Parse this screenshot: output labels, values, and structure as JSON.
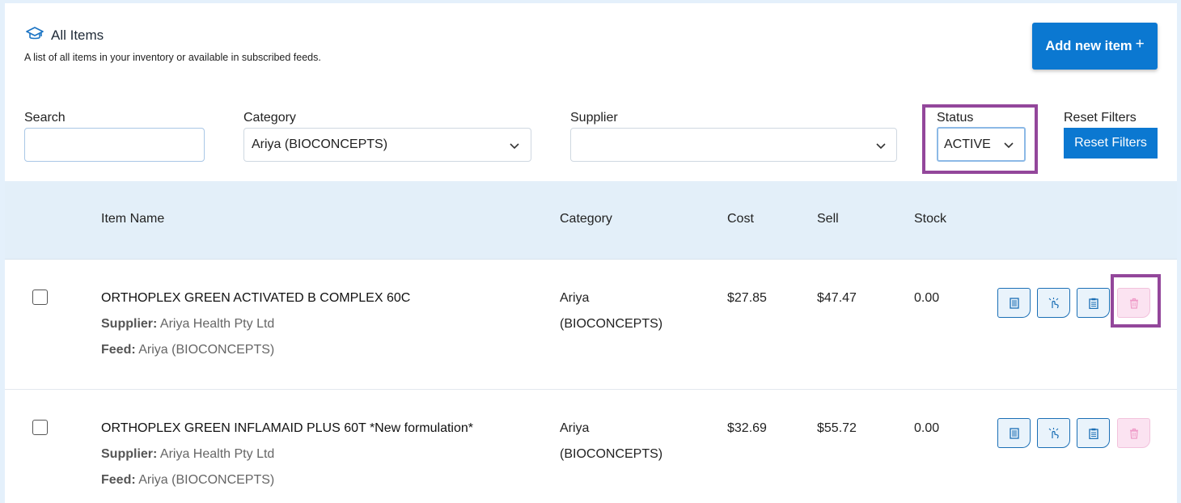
{
  "header": {
    "title": "All Items",
    "subtitle": "A list of all items in your inventory or available in subscribed feeds.",
    "add_button_label": "Add new item",
    "add_button_symbol": "+"
  },
  "filters": {
    "search_label": "Search",
    "search_value": "",
    "category_label": "Category",
    "category_value": "Ariya (BIOCONCEPTS)",
    "supplier_label": "Supplier",
    "supplier_value": "",
    "status_label": "Status",
    "status_value": "ACTIVE",
    "reset_label": "Reset Filters",
    "reset_button_label": "Reset Filters"
  },
  "table": {
    "columns": [
      "Item Name",
      "Category",
      "Cost",
      "Sell",
      "Stock"
    ],
    "supplier_key": "Supplier:",
    "feed_key": "Feed:",
    "rows": [
      {
        "name": "ORTHOPLEX GREEN ACTIVATED B COMPLEX 60C",
        "supplier": "Ariya Health Pty Ltd",
        "feed": "Ariya (BIOCONCEPTS)",
        "category_line1": "Ariya",
        "category_line2": "(BIOCONCEPTS)",
        "cost": "$27.85",
        "sell": "$47.47",
        "stock": "0.00"
      },
      {
        "name": "ORTHOPLEX GREEN INFLAMAID PLUS 60T *New formulation*",
        "supplier": "Ariya Health Pty Ltd",
        "feed": "Ariya (BIOCONCEPTS)",
        "category_line1": "Ariya",
        "category_line2": "(BIOCONCEPTS)",
        "cost": "$32.69",
        "sell": "$55.72",
        "stock": "0.00"
      }
    ]
  },
  "icons": {
    "header": "graduation-cap-icon",
    "actions": [
      "barcode-icon",
      "hand-pointer-icon",
      "clipboard-icon",
      "trash-icon"
    ]
  },
  "colors": {
    "primary": "#0b78d1",
    "highlight": "#93479b",
    "header_bg": "#e3eff9",
    "delete_bg": "#fbe3f1"
  }
}
